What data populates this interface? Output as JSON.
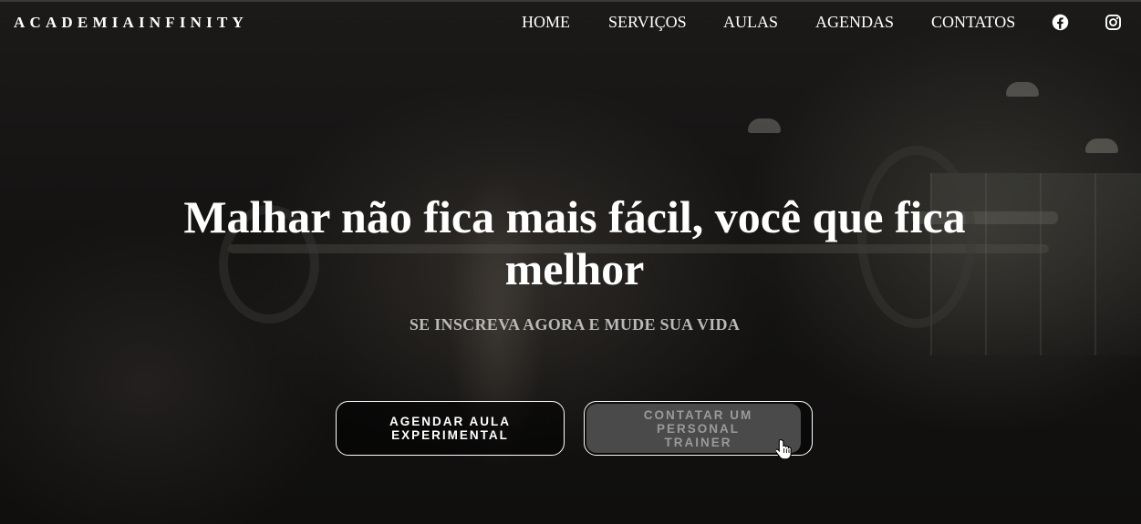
{
  "header": {
    "brand": "ACADEMIAINFINITY",
    "nav": [
      {
        "label": "HOME"
      },
      {
        "label": "SERVIÇOS"
      },
      {
        "label": "AULAS"
      },
      {
        "label": "AGENDAS"
      },
      {
        "label": "CONTATOS"
      }
    ],
    "social_icons": [
      "facebook-icon",
      "instagram-icon"
    ]
  },
  "hero": {
    "headline": "Malhar não fica mais fácil, você que fica melhor",
    "subtitle": "SE INSCREVA AGORA E MUDE SUA VIDA",
    "buttons": [
      {
        "label": "AGENDAR AULA EXPERIMENTAL"
      },
      {
        "label": "CONTATAR UM PERSONAL TRAINER",
        "state": "hover"
      }
    ]
  },
  "colors": {
    "text": "#ffffff",
    "subtitle": "#b9b9b9",
    "hover_button_bg": "#4a4a4a",
    "hover_button_text": "#9a9a9a"
  },
  "cursor": "hand-pointer-icon"
}
